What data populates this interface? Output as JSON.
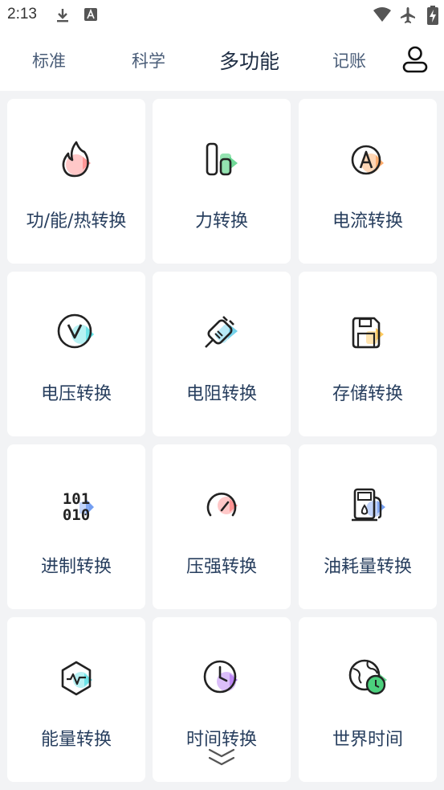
{
  "status": {
    "time": "2:13",
    "icons": [
      "download-icon",
      "keyboard-a-icon",
      "wifi-icon",
      "airplane-icon",
      "battery-charging-icon"
    ]
  },
  "tabs": [
    {
      "label": "标准",
      "active": false
    },
    {
      "label": "科学",
      "active": false
    },
    {
      "label": "多功能",
      "active": true
    },
    {
      "label": "记账",
      "active": false
    }
  ],
  "profile_icon": "user-icon",
  "colors": {
    "page_bg": "#f2f3f5",
    "card_bg": "#ffffff",
    "label_text": "#273e5e",
    "accent_red": "#ff6b6b",
    "accent_green": "#4cd07d",
    "accent_orange": "#ff9a4d",
    "accent_cyan": "#3fd9e0",
    "accent_yellow": "#ffbf3f",
    "accent_blue": "#5b8def",
    "accent_purple": "#a35bf0"
  },
  "cards": [
    {
      "label": "功/能/热转换",
      "icon": "flame-icon"
    },
    {
      "label": "力转换",
      "icon": "force-bars-icon"
    },
    {
      "label": "电流转换",
      "icon": "ampere-icon"
    },
    {
      "label": "电压转换",
      "icon": "voltage-icon"
    },
    {
      "label": "电阻转换",
      "icon": "plug-icon"
    },
    {
      "label": "存储转换",
      "icon": "floppy-disk-icon"
    },
    {
      "label": "进制转换",
      "icon": "binary-icon"
    },
    {
      "label": "压强转换",
      "icon": "pressure-gauge-icon"
    },
    {
      "label": "油耗量转换",
      "icon": "fuel-pump-icon"
    },
    {
      "label": "能量转换",
      "icon": "energy-hexagon-icon"
    },
    {
      "label": "时间转换",
      "icon": "clock-icon"
    },
    {
      "label": "世界时间",
      "icon": "globe-clock-icon"
    }
  ],
  "more_icon": "chevron-double-down-icon"
}
